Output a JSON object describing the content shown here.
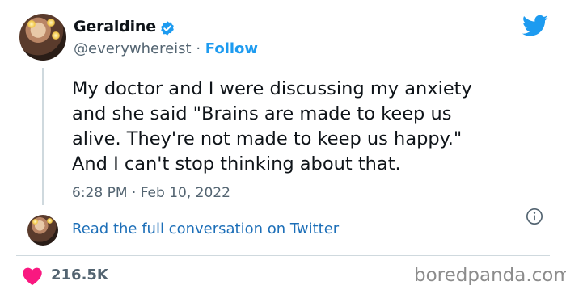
{
  "author": {
    "name": "Geraldine",
    "handle": "@everywhereist",
    "separator": "·",
    "follow_label": "Follow",
    "verified": true
  },
  "tweet": {
    "text": "My doctor and I were discussing my anxiety\nand she said \"Brains are made to keep us\nalive. They're not made to keep us happy.\"\nAnd I can't stop thinking about that.",
    "timestamp": "6:28 PM · Feb 10, 2022"
  },
  "conversation_link": "Read the full conversation on Twitter",
  "engagement": {
    "likes": "216.5K"
  },
  "watermark": "boredpanda.com",
  "colors": {
    "accent": "#1d9bf0",
    "heart": "#f91880",
    "muted": "#536471"
  },
  "icons": [
    "verified-badge-icon",
    "twitter-bird-icon",
    "info-icon",
    "heart-icon"
  ]
}
